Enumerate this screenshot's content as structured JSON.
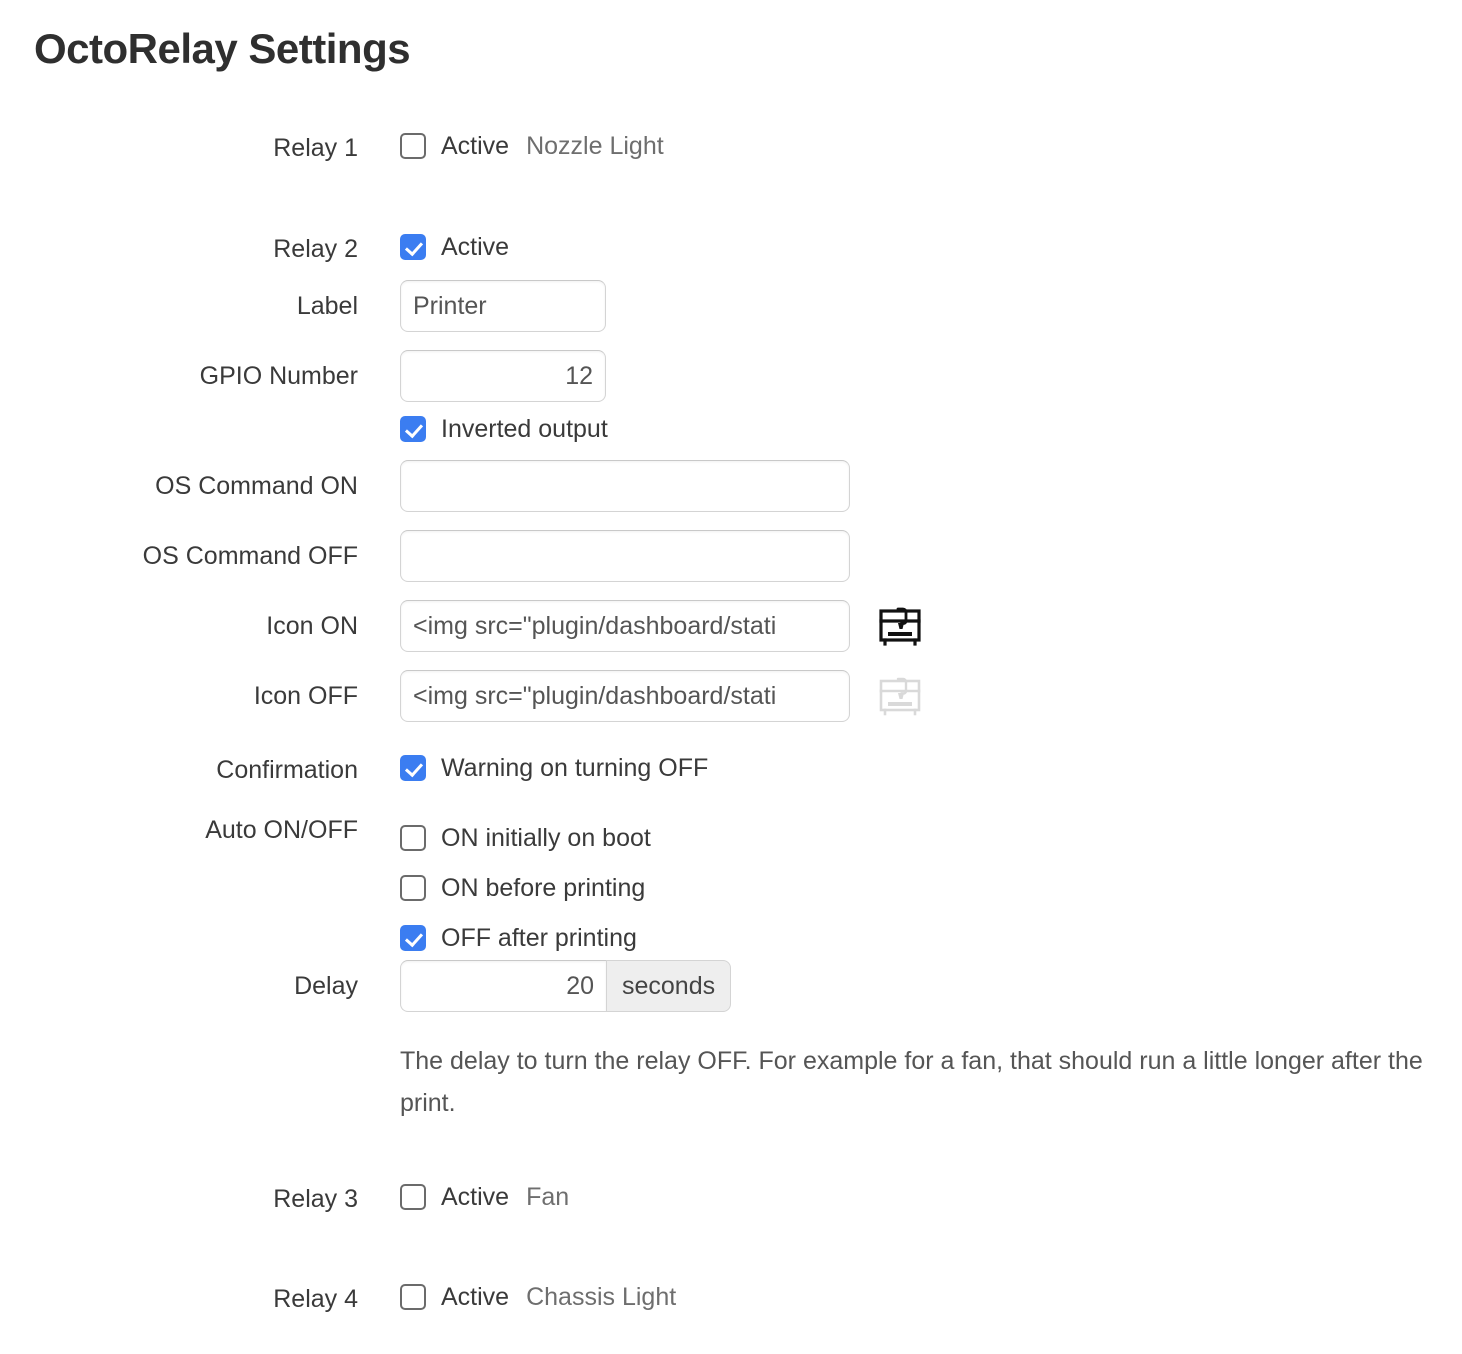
{
  "page": {
    "title": "OctoRelay Settings"
  },
  "labels": {
    "relay1": "Relay 1",
    "relay2": "Relay 2",
    "relay3": "Relay 3",
    "relay4": "Relay 4",
    "active": "Active",
    "label": "Label",
    "gpio_number": "GPIO Number",
    "inverted_output": "Inverted output",
    "os_command_on": "OS Command ON",
    "os_command_off": "OS Command OFF",
    "icon_on": "Icon ON",
    "icon_off": "Icon OFF",
    "confirmation": "Confirmation",
    "warning_on_turning_off": "Warning on turning OFF",
    "auto_on_off": "Auto ON/OFF",
    "on_initially_on_boot": "ON initially on boot",
    "on_before_printing": "ON before printing",
    "off_after_printing": "OFF after printing",
    "delay": "Delay",
    "seconds": "seconds"
  },
  "relays": {
    "relay1": {
      "title": "Relay 1",
      "active": false,
      "name": "Nozzle Light"
    },
    "relay2": {
      "title": "Relay 2",
      "active": true,
      "label_value": "Printer",
      "gpio_value": "12",
      "inverted": true,
      "os_command_on_value": "",
      "os_command_off_value": "",
      "icon_on_value": "<img src=\"plugin/dashboard/stati",
      "icon_off_value": "<img src=\"plugin/dashboard/stati",
      "icon_on_name": "printer-3d-icon",
      "icon_off_name": "printer-3d-icon-muted",
      "confirmation": true,
      "on_initially_on_boot": false,
      "on_before_printing": false,
      "off_after_printing": true,
      "delay_value": "20",
      "delay_unit": "seconds",
      "delay_help": "The delay to turn the relay OFF. For example for a fan, that should run a little longer after the print."
    },
    "relay3": {
      "title": "Relay 3",
      "active": false,
      "name": "Fan"
    },
    "relay4": {
      "title": "Relay 4",
      "active": false,
      "name": "Chassis Light"
    }
  },
  "colors": {
    "checkbox_checked": "#3b7df1",
    "text": "#3a3a3a",
    "muted_text": "#6e6e6e",
    "input_text": "#555555",
    "addon_bg": "#eeeeee",
    "icon_on": "#111111",
    "icon_off": "#d9d9d9"
  }
}
